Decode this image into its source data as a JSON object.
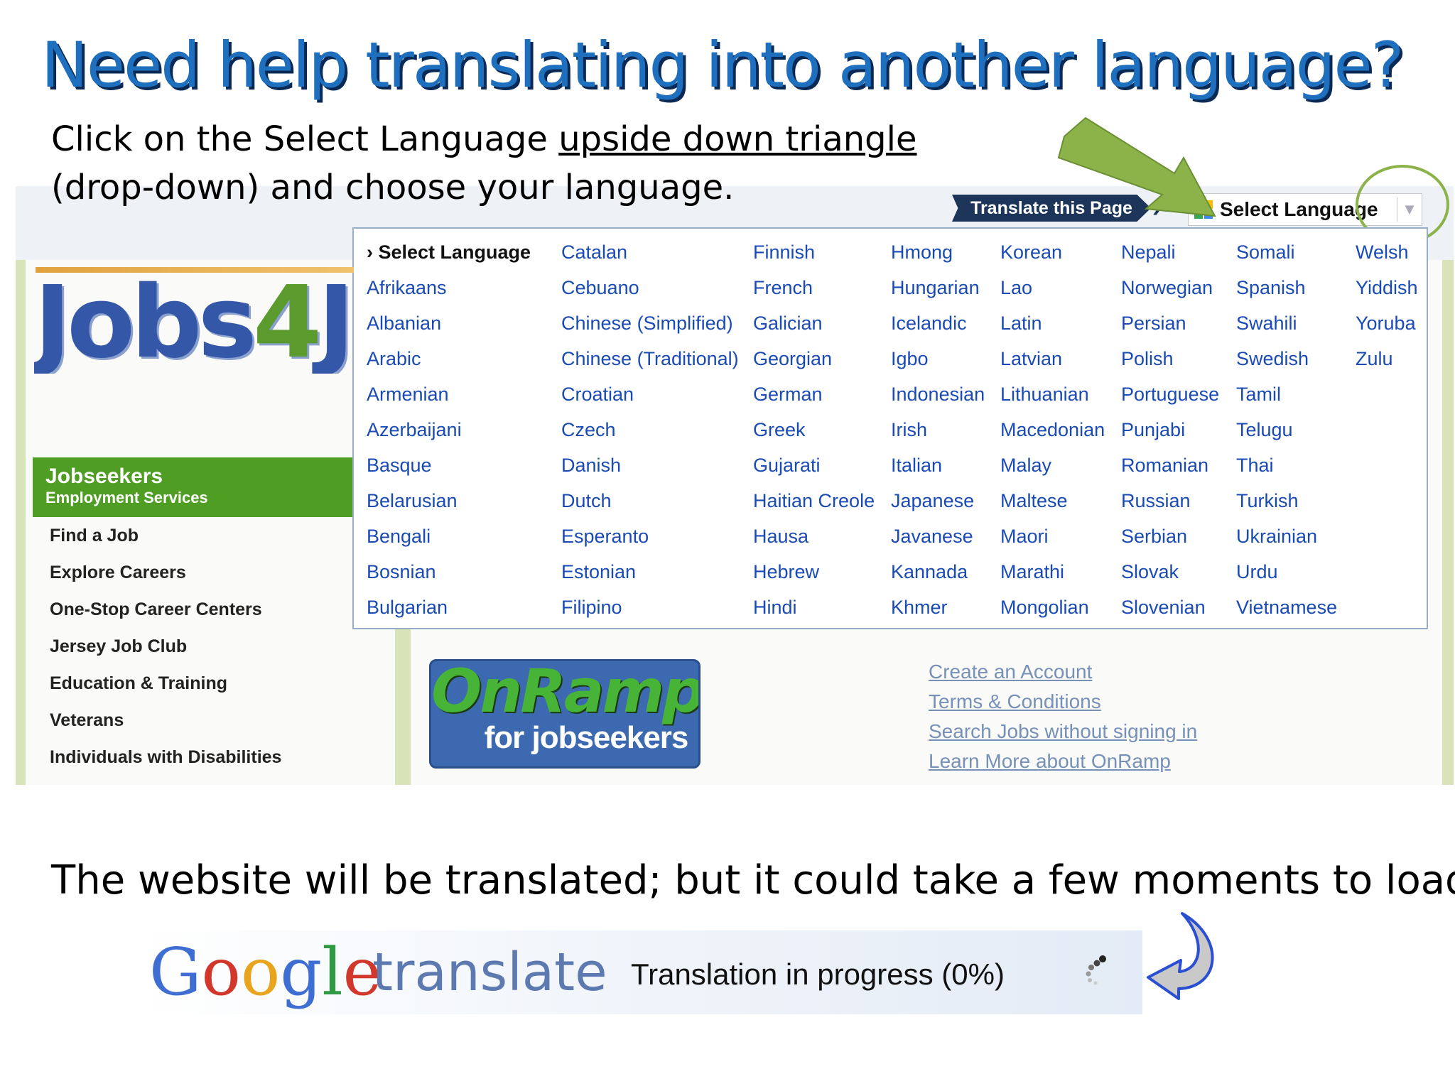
{
  "slide": {
    "title": "Need help translating into another language?",
    "instruction_line1_pre": "Click on the Select Language ",
    "instruction_line1_underlined": "upside down triangle",
    "instruction_line2": "(drop-down) and choose your language.",
    "bottom_text": "The website will be translated; but it could take a few moments to load"
  },
  "translate_bar": {
    "button_label": "Translate this Page",
    "select_label": "Select Language"
  },
  "language_menu": {
    "columns": [
      [
        "› Select Language",
        "Afrikaans",
        "Albanian",
        "Arabic",
        "Armenian",
        "Azerbaijani",
        "Basque",
        "Belarusian",
        "Bengali",
        "Bosnian",
        "Bulgarian"
      ],
      [
        "Catalan",
        "Cebuano",
        "Chinese (Simplified)",
        "Chinese (Traditional)",
        "Croatian",
        "Czech",
        "Danish",
        "Dutch",
        "Esperanto",
        "Estonian",
        "Filipino"
      ],
      [
        "Finnish",
        "French",
        "Galician",
        "Georgian",
        "German",
        "Greek",
        "Gujarati",
        "Haitian Creole",
        "Hausa",
        "Hebrew",
        "Hindi"
      ],
      [
        "Hmong",
        "Hungarian",
        "Icelandic",
        "Igbo",
        "Indonesian",
        "Irish",
        "Italian",
        "Japanese",
        "Javanese",
        "Kannada",
        "Khmer"
      ],
      [
        "Korean",
        "Lao",
        "Latin",
        "Latvian",
        "Lithuanian",
        "Macedonian",
        "Malay",
        "Maltese",
        "Maori",
        "Marathi",
        "Mongolian"
      ],
      [
        "Nepali",
        "Norwegian",
        "Persian",
        "Polish",
        "Portuguese",
        "Punjabi",
        "Romanian",
        "Russian",
        "Serbian",
        "Slovak",
        "Slovenian"
      ],
      [
        "Somali",
        "Spanish",
        "Swahili",
        "Swedish",
        "Tamil",
        "Telugu",
        "Thai",
        "Turkish",
        "Ukrainian",
        "Urdu",
        "Vietnamese"
      ],
      [
        "Welsh",
        "Yiddish",
        "Yoruba",
        "Zulu"
      ]
    ]
  },
  "site": {
    "logo_part1": "Jobs",
    "logo_part2": "4",
    "logo_part3": "Jersey",
    "nav_header_title": "Jobseekers",
    "nav_header_subtitle": "Employment Services",
    "nav_items": [
      "Find a Job",
      "Explore Careers",
      "One-Stop Career Centers",
      "Jersey Job Club",
      "Education & Training",
      "Veterans",
      "Individuals with Disabilities"
    ],
    "onramp_title": "OnRamp",
    "onramp_subtitle": "for jobseekers",
    "account_links": [
      "Create an Account",
      "Terms & Conditions",
      "Search Jobs without signing in",
      "Learn More about OnRamp"
    ]
  },
  "google_translate": {
    "logo_letters": [
      "G",
      "o",
      "o",
      "g",
      "l",
      "e"
    ],
    "product": "translate",
    "progress_text": "Translation in progress (0%)"
  },
  "colors": {
    "title_blue": "#1f6fbf",
    "link_blue": "#1a4bb5",
    "nav_green": "#4f9e23",
    "arrow_green": "#8bb34a"
  },
  "icons": [
    "google-logo-icon",
    "dropdown-arrow-icon",
    "green-pointer-arrow",
    "spinner-icon",
    "curved-arrow-icon"
  ]
}
